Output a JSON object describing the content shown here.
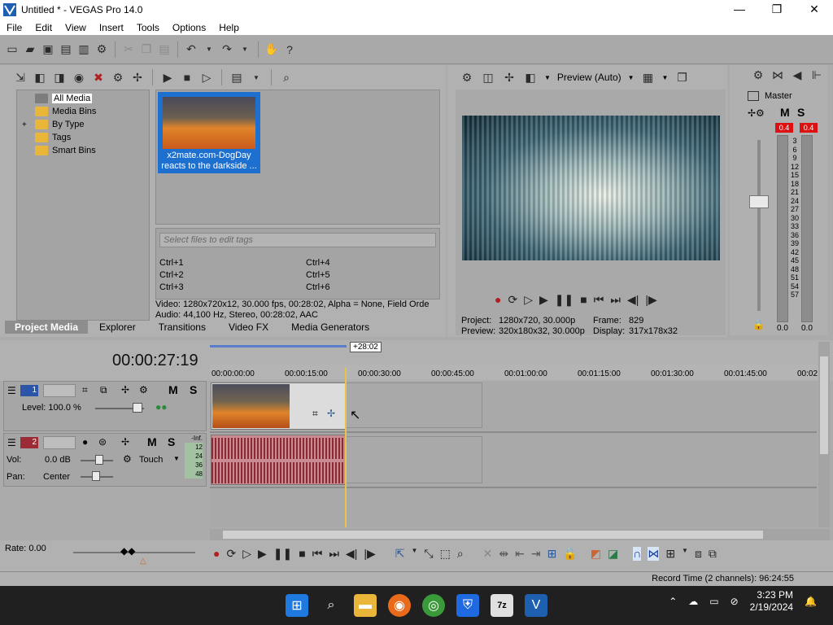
{
  "window": {
    "title": "Untitled * - VEGAS Pro 14.0",
    "minimize": "—",
    "maximize": "❐",
    "close": "✕"
  },
  "menu": [
    "File",
    "Edit",
    "View",
    "Insert",
    "Tools",
    "Options",
    "Help"
  ],
  "project_media": {
    "tree": [
      "All Media",
      "Media Bins",
      "By Type",
      "Tags",
      "Smart Bins"
    ],
    "expand_marker": "+",
    "clip_caption": "x2mate.com-DogDay reacts to the darkside ...",
    "tag_placeholder": "Select files to edit tags",
    "shortcuts": [
      "Ctrl+1",
      "Ctrl+4",
      "Ctrl+2",
      "Ctrl+5",
      "Ctrl+3",
      "Ctrl+6"
    ],
    "video_info": "Video: 1280x720x12, 30.000 fps, 00:28:02, Alpha = None, Field Orde",
    "audio_info": "Audio: 44,100 Hz, Stereo, 00:28:02, AAC"
  },
  "tabs": [
    "Project Media",
    "Explorer",
    "Transitions",
    "Video FX",
    "Media Generators"
  ],
  "preview": {
    "mode": "Preview (Auto)",
    "project_label": "Project:",
    "project_value": "1280x720, 30.000p",
    "preview_label": "Preview:",
    "preview_value": "320x180x32, 30.000p",
    "frame_label": "Frame:",
    "frame_value": "829",
    "display_label": "Display:",
    "display_value": "317x178x32"
  },
  "master": {
    "label": "Master",
    "m": "M",
    "s": "S",
    "peak_l": "0.4",
    "peak_r": "0.4",
    "scale": [
      "3",
      "6",
      "9",
      "12",
      "15",
      "18",
      "21",
      "24",
      "27",
      "30",
      "33",
      "36",
      "39",
      "42",
      "45",
      "48",
      "51",
      "54",
      "57"
    ],
    "level_l": "0.0",
    "level_r": "0.0"
  },
  "timeline": {
    "timecode": "00:00:27:19",
    "duration_badge": "+28:02",
    "ruler": [
      "00:00:00:00",
      "00:00:15:00",
      "00:00:30:00",
      "00:00:45:00",
      "00:01:00:00",
      "00:01:15:00",
      "00:01:30:00",
      "00:01:45:00",
      "00:02"
    ],
    "video_track": {
      "number": "1",
      "m": "M",
      "s": "S",
      "level_label": "Level: 100.0 %"
    },
    "audio_track": {
      "number": "2",
      "m": "M",
      "s": "S",
      "vol_label": "Vol:",
      "vol_value": "0.0 dB",
      "pan_label": "Pan:",
      "pan_value": "Center",
      "mode": "Touch",
      "meter_scale": [
        "-Inf.",
        "12",
        "24",
        "36",
        "48"
      ]
    },
    "rate": "Rate: 0.00",
    "record_time": "Record Time (2 channels): 96:24:55"
  },
  "taskbar": {
    "time": "3:23 PM",
    "date": "2/19/2024"
  }
}
